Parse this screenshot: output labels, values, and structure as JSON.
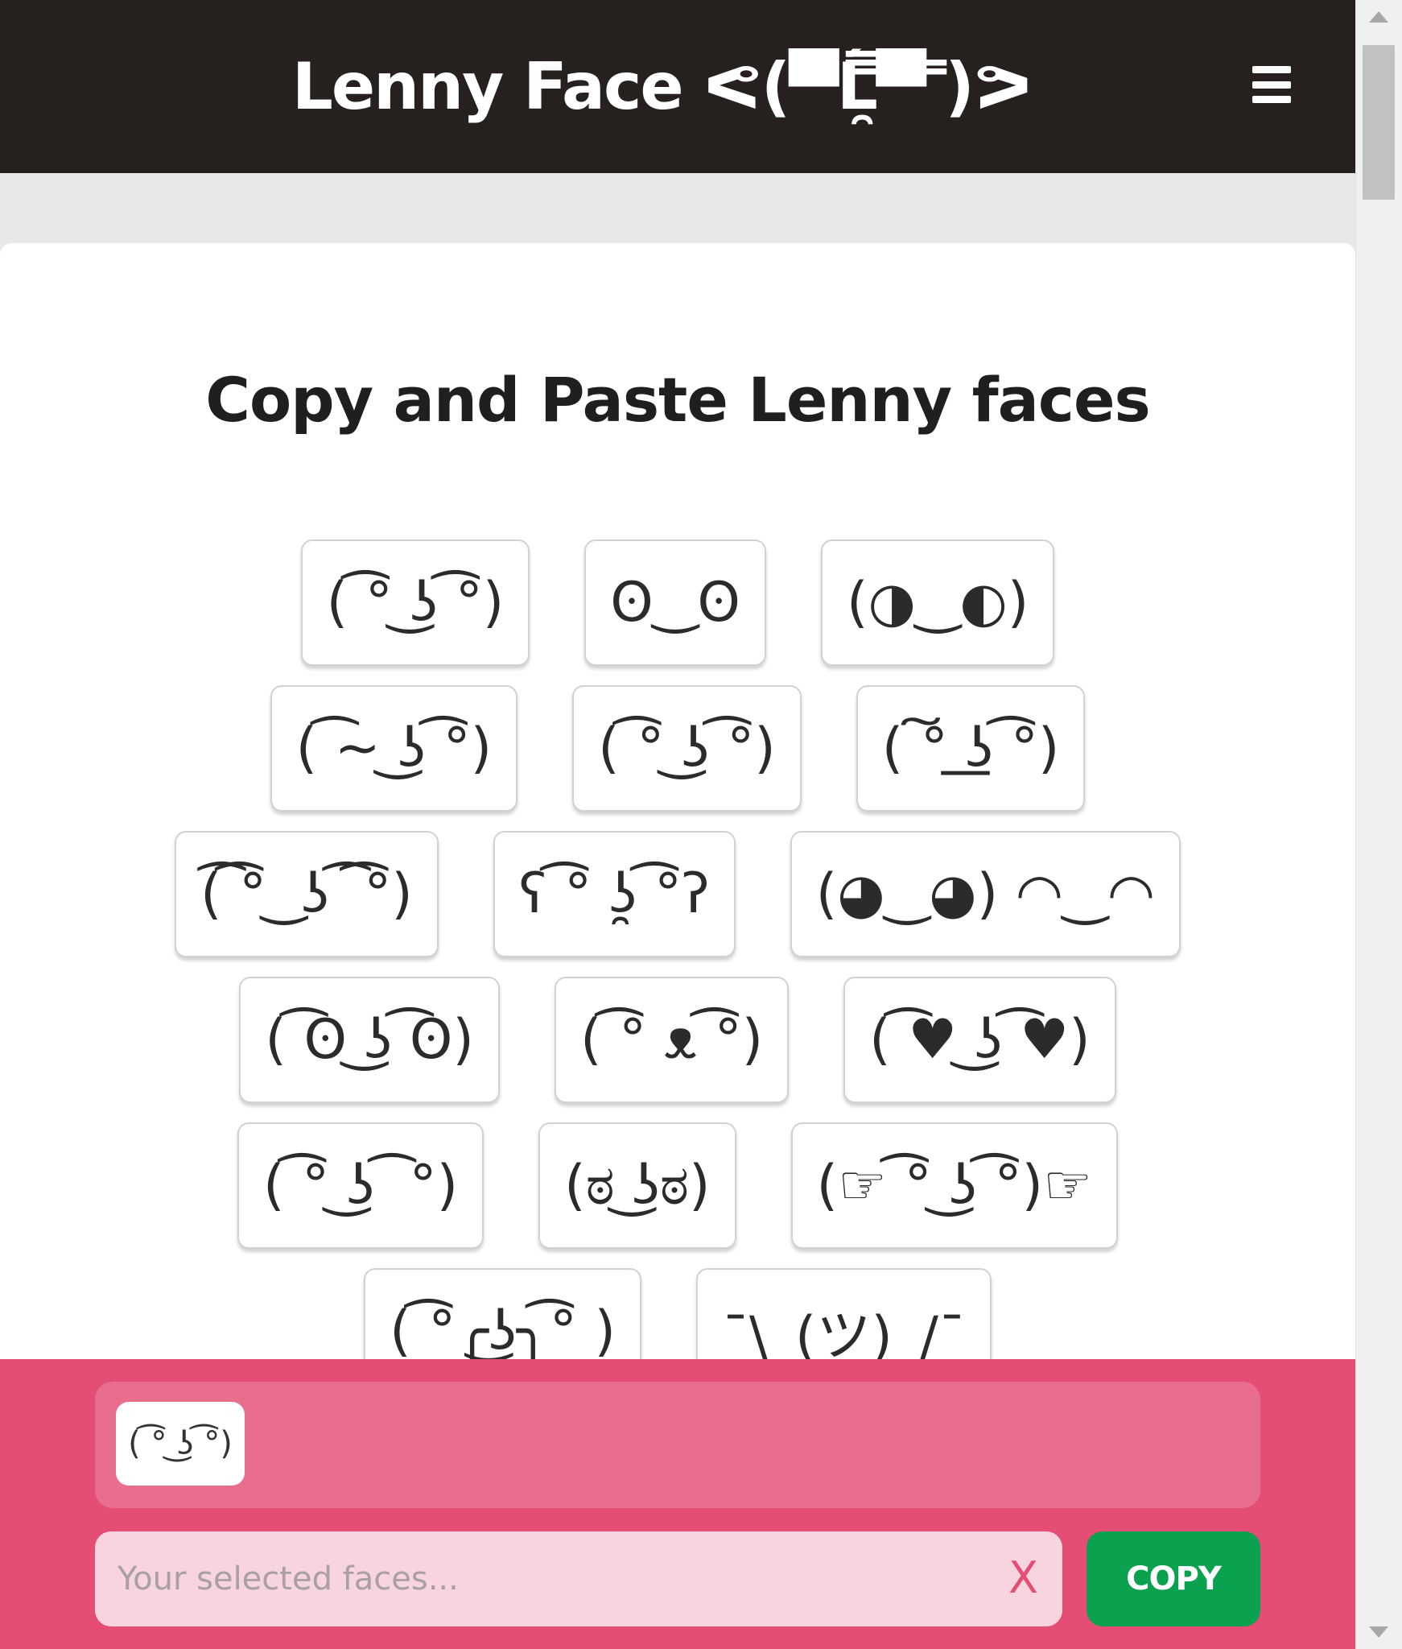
{
  "header": {
    "brand": "Lenny Face ᕙ(▀̿̿Ĺ̯̿̿▀̿ ̿)ᕗ",
    "menu_icon": "hamburger-menu-icon"
  },
  "main": {
    "title": "Copy and Paste Lenny faces",
    "rows": [
      [
        "( ͡° ͜ʖ ͡°)",
        "ʘ‿ʘ",
        "(◑‿◐)"
      ],
      [
        "( ͡~ ͜ʖ ͡°)",
        "( ͡° ͜ʖ ͡°)",
        "( ͠° ͟ʖ ͡°)"
      ],
      [
        "(͡ ͡° ͜ ʖ ͡ ͡°)",
        "ʕ ͡° ʖ̯ ͡°ʔ",
        "(◕‿◕) ◠‿◠"
      ],
      [
        "( ͡ʘ ͜ʖ ͡ʘ)",
        "( ͡° ᴥ ͡°)",
        "( ͡♥ ͜ʖ ͡♥)"
      ],
      [
        "( ͡° ͜ʖ ͡ °)",
        "(ಠ ͜ʖಠ)",
        "(☞ ͡° ͜ʖ ͡°)☞"
      ],
      [
        "( ͡°╭͜ʖ╮͡° )",
        "¯\\_(ツ)_/¯"
      ]
    ]
  },
  "bottom": {
    "selected_chip": "( ͡° ͜ʖ ͡°)",
    "input_placeholder": "Your selected faces...",
    "clear_label": "X",
    "copy_label": "COPY"
  },
  "colors": {
    "header_bg": "#26211f",
    "bottom_bg": "#e44d74",
    "copy_bg": "#0ba24f"
  }
}
